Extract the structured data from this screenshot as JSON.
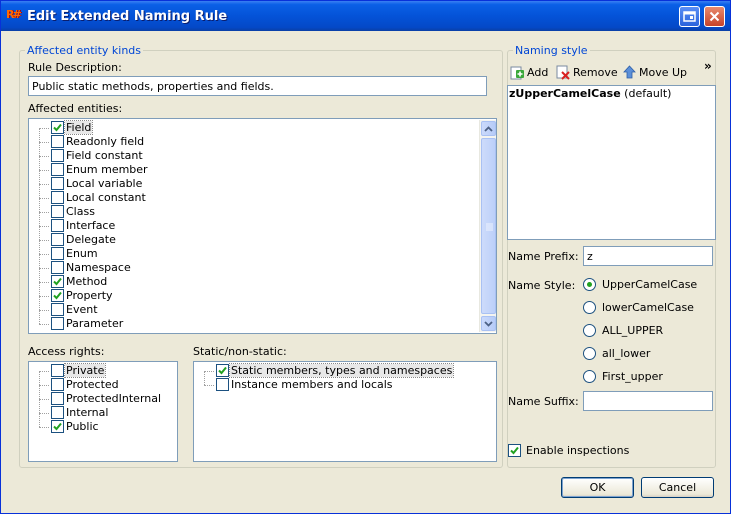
{
  "window": {
    "title": "Edit Extended Naming Rule",
    "app_icon_text": "R#"
  },
  "affected_group": {
    "legend": "Affected entity kinds",
    "rule_description_label": "Rule Description:",
    "rule_description_value": "Public static methods, properties and fields.",
    "affected_entities_label": "Affected entities:",
    "entities": [
      {
        "label": "Field",
        "checked": true,
        "selected": true
      },
      {
        "label": "Readonly field",
        "checked": false
      },
      {
        "label": "Field constant",
        "checked": false
      },
      {
        "label": "Enum member",
        "checked": false
      },
      {
        "label": "Local variable",
        "checked": false
      },
      {
        "label": "Local constant",
        "checked": false
      },
      {
        "label": "Class",
        "checked": false
      },
      {
        "label": "Interface",
        "checked": false
      },
      {
        "label": "Delegate",
        "checked": false
      },
      {
        "label": "Enum",
        "checked": false
      },
      {
        "label": "Namespace",
        "checked": false
      },
      {
        "label": "Method",
        "checked": true
      },
      {
        "label": "Property",
        "checked": true
      },
      {
        "label": "Event",
        "checked": false
      },
      {
        "label": "Parameter",
        "checked": false
      }
    ],
    "access_rights_label": "Access rights:",
    "access_rights": [
      {
        "label": "Private",
        "checked": false,
        "selected": true
      },
      {
        "label": "Protected",
        "checked": false
      },
      {
        "label": "ProtectedInternal",
        "checked": false
      },
      {
        "label": "Internal",
        "checked": false
      },
      {
        "label": "Public",
        "checked": true
      }
    ],
    "static_label": "Static/non-static:",
    "static_options": [
      {
        "label": "Static members, types and namespaces",
        "checked": true,
        "selected": true
      },
      {
        "label": "Instance members and locals",
        "checked": false
      }
    ]
  },
  "naming_group": {
    "legend": "Naming style",
    "toolbar": {
      "add_label": "Add",
      "remove_label": "Remove",
      "move_up_label": "Move Up",
      "overflow_label": "»"
    },
    "styles": [
      {
        "name": "zUpperCamelCase",
        "suffix": " (default)"
      }
    ],
    "prefix_label": "Name Prefix:",
    "prefix_value": "z",
    "style_label": "Name Style:",
    "style_options": [
      {
        "label": "UpperCamelCase",
        "selected": true
      },
      {
        "label": "lowerCamelCase",
        "selected": false
      },
      {
        "label": "ALL_UPPER",
        "selected": false
      },
      {
        "label": "all_lower",
        "selected": false
      },
      {
        "label": "First_upper",
        "selected": false
      }
    ],
    "suffix_label": "Name Suffix:",
    "suffix_value": "",
    "enable_inspections_label": "Enable inspections",
    "enable_inspections_checked": true
  },
  "buttons": {
    "ok_label": "OK",
    "cancel_label": "Cancel"
  },
  "colors": {
    "titlebar": "#0453d8",
    "group_legend": "#0046d5",
    "check": "#21a121",
    "selection": "#e8e8e8"
  }
}
